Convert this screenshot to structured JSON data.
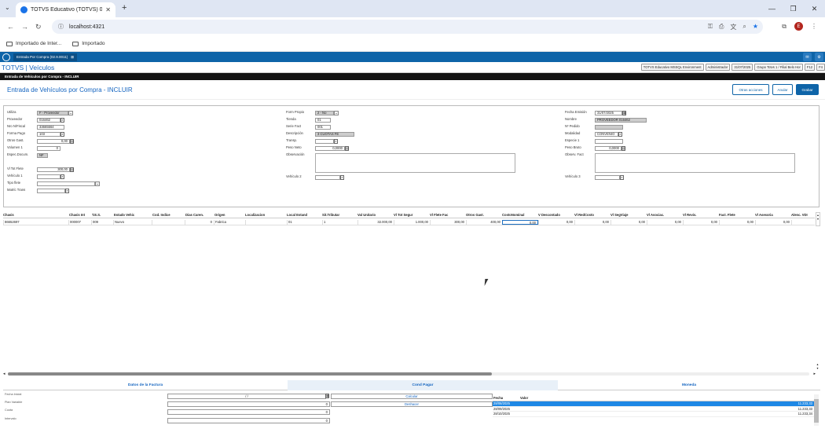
{
  "browser": {
    "tab_title": "TOTVS Educativo (TOTVS) 02.9.0011",
    "url": "localhost:4321",
    "bookmarks": [
      "Importado de Inter...",
      "Importado"
    ],
    "avatar_letter": "E"
  },
  "app": {
    "tab_label": "Entrada Por Compra (02.9.0011)",
    "brand": "TOTVS | Veículos",
    "env": "TOTVS Educativo MSSQL Environment",
    "user": "Administrador",
    "date": "31/07/2025",
    "company": "Grupo Totvs 1 / Filial Belo Hor",
    "f12": "F12",
    "f4": "F4",
    "screen_bar": "Entrada de Vehículos por Compra - INCLUIR",
    "title": "Entrada de Vehículos por Compra - INCLUIR",
    "btn_other": "Otras acciones",
    "btn_cancel": "Anular",
    "btn_save": "Grabar"
  },
  "form": {
    "utiliza": {
      "label": "Utiliza",
      "value": "F - Proveedor"
    },
    "proveedor": {
      "label": "Proveedor",
      "value": "016462"
    },
    "nro_fiscal": {
      "label": "Nro N/Fiscal",
      "value": "33665564"
    },
    "forma_pago": {
      "label": "Forma Pago",
      "value": "103"
    },
    "otros_gast": {
      "label": "Otros Gast.",
      "value": "0,00"
    },
    "volumen": {
      "label": "Volumen 1",
      "value": "0"
    },
    "espec_docum": {
      "label": "Espec.Docum.",
      "value": "NF"
    },
    "vl_tot_flete": {
      "label": "Vl Tot Flete",
      "value": "300,00"
    },
    "vehiculo1": {
      "label": "Vehículo 1",
      "value": ""
    },
    "tipo_flete": {
      "label": "Tipo flete",
      "value": ""
    },
    "matric_trans": {
      "label": "Matríc Trans",
      "value": ""
    },
    "form_propio": {
      "label": "Form Propio",
      "value": "2 - No"
    },
    "tienda": {
      "label": "Tienda",
      "value": "01"
    },
    "serie_fact": {
      "label": "Serie Fact",
      "value": "001"
    },
    "descripcion": {
      "label": "Descripción",
      "value": "3 CUOTAS FE"
    },
    "transp": {
      "label": "Transp.",
      "value": ""
    },
    "peso_neto": {
      "label": "Peso Neto",
      "value": "0,0000"
    },
    "observacion": {
      "label": "Observación"
    },
    "vehiculo2": {
      "label": "Vehículo 2",
      "value": ""
    },
    "fecha_emision": {
      "label": "Fecha Emisión",
      "value": "31/07/2025"
    },
    "nombre": {
      "label": "Nombre",
      "value": "PROVEEDOR 016462"
    },
    "nro_pedido": {
      "label": "Nº Pedido",
      "value": ""
    },
    "modalidad": {
      "label": "Modalidad",
      "value": "CONVENIO"
    },
    "especie1": {
      "label": "Especie 1",
      "value": ""
    },
    "peso_bruto": {
      "label": "Peso Bruto",
      "value": "0,0000"
    },
    "observ_fact": {
      "label": "Observ. Fact"
    },
    "vehiculo3": {
      "label": "Vehículo 3",
      "value": ""
    }
  },
  "grid": {
    "headers": [
      "Chasis",
      "Chasis Int",
      "T.E.S.",
      "Estado Vehic",
      "Cod. Indice",
      "Dias Caren.",
      "Origen",
      "Localizacion",
      "Local Estand",
      "Sit.Tributar",
      "Val Unitario",
      "Vl Tot Segur",
      "Vl Flete Fac",
      "Otros Gast.",
      "CostoNominal",
      "V Descontado",
      "Vl RedCosto",
      "Vl SegViaje",
      "Vl Asociac.",
      "Vl Revis.",
      "Fact. Flete",
      "Vl Asesoria",
      "Alenc. VDI"
    ],
    "row": [
      "86652697",
      "000007",
      "009",
      "Nuevo",
      "",
      "0",
      "Fabrica",
      "",
      "01",
      "1",
      "32.000,00",
      "1.000,00",
      "300,00",
      "400,00",
      "0,00",
      "0,00",
      "0,00",
      "0,00",
      "0,00",
      "0,00",
      "0,00",
      "0,00",
      ""
    ]
  },
  "bottom_tabs": [
    "Datos de la Factura",
    "Cond Pagar",
    "Moneda"
  ],
  "payment": {
    "labels": [
      "Fecha Inicial",
      "Plan Variable",
      "Cuota",
      "Intervalo"
    ],
    "date_value": "/ /",
    "values": [
      "0",
      "0",
      "0"
    ],
    "btn_calc": "Calcular",
    "btn_undo": "Deshacer",
    "table_headers": [
      "Fecha",
      "Valor"
    ],
    "rows": [
      [
        "28/08/2025",
        "11.233,33"
      ],
      [
        "28/09/2025",
        "11.233,33"
      ],
      [
        "28/10/2025",
        "11.233,34"
      ]
    ]
  }
}
